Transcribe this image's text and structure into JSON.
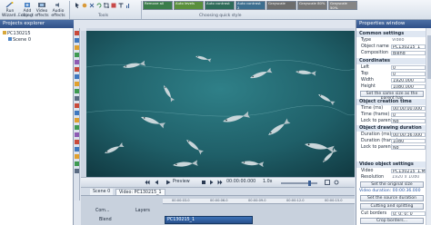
{
  "ribbon": {
    "run_wizard": "Run Wizard...",
    "add_object": "Add object",
    "add_video_effects": "Video effects",
    "add_audio_effects": "Audio effects",
    "editing_label": "Editing",
    "tools_label": "Tools",
    "quick_style_label": "Choosing quick style",
    "styles": [
      {
        "label": "Remove all",
        "color": "#3b7d4a"
      },
      {
        "label": "Auto levels",
        "color": "#5a8f3c"
      },
      {
        "label": "Auto contrast",
        "color": "#2f6b59"
      },
      {
        "label": "Auto contrast 2",
        "color": "#3d6e8f"
      },
      {
        "label": "Grayscale",
        "color": "#6d6d6d"
      },
      {
        "label": "Grayscale 80%",
        "color": "#777777"
      },
      {
        "label": "Grayscale 50%",
        "color": "#868686"
      }
    ]
  },
  "explorer": {
    "title": "Projects explorer",
    "project_name": "PC130215",
    "scene_name": "Scene 0"
  },
  "playback": {
    "preview_label": "Preview",
    "time": "00:00:00.000",
    "zoom": "1.0x"
  },
  "scene_tabs": {
    "scene": "Scene 0",
    "video": "Video: PC130215_1"
  },
  "timeline": {
    "layers_label": "Layers",
    "com_label": "Com...",
    "blend_label": "Blend",
    "ticks": [
      "00:00:03.0",
      "00:00:06.0",
      "00:00:09.0",
      "00:00:12.0",
      "00:00:15.0"
    ],
    "clip_label": "PC130215_1"
  },
  "properties": {
    "title": "Properties window",
    "common": {
      "header": "Common settings",
      "type_label": "Type",
      "type_value": "Video",
      "name_label": "Object name",
      "name_value": "PC130215_1",
      "comp_label": "Composition",
      "comp_value": "Blend"
    },
    "coords": {
      "header": "Coordinates",
      "left_label": "Left",
      "left_value": "0",
      "top_label": "Top",
      "top_value": "0",
      "width_label": "Width",
      "width_value": "1920.000",
      "height_label": "Height",
      "height_value": "1080.000",
      "same_size_btn": "Set the same size as the parent has"
    },
    "creation": {
      "header": "Object creation time",
      "time_label": "Time (ms)",
      "time_value": "00:00:00.000",
      "frame_label": "Time (frame)",
      "frame_value": "0",
      "lock_label": "Lock to parent",
      "lock_value": "No"
    },
    "drawing": {
      "header": "Object drawing duration",
      "ms_label": "Duration (ms)",
      "ms_value": "00:00:36.000",
      "frame_label": "Duration (frame)",
      "frame_value": "1080",
      "lock_label": "Lock to parent",
      "lock_value": "No"
    },
    "video": {
      "header": "Video object settings",
      "video_label": "Video",
      "video_value": "PC130215_1.MOV",
      "res_label": "Resolution",
      "res_value": "1920 x 1080",
      "orig_size_btn": "Set the original size",
      "duration_link": "Video duration: 00:00:36.000",
      "source_btn": "Set the source duration",
      "cutting_btn": "Cutting and splitting",
      "cut_label": "Cut borders",
      "cut_value": "0; 0; 0; 0",
      "crop_btn": "Crop borders..."
    }
  },
  "colors": {
    "accent": "#2f5088",
    "water": "#1f5a63"
  }
}
